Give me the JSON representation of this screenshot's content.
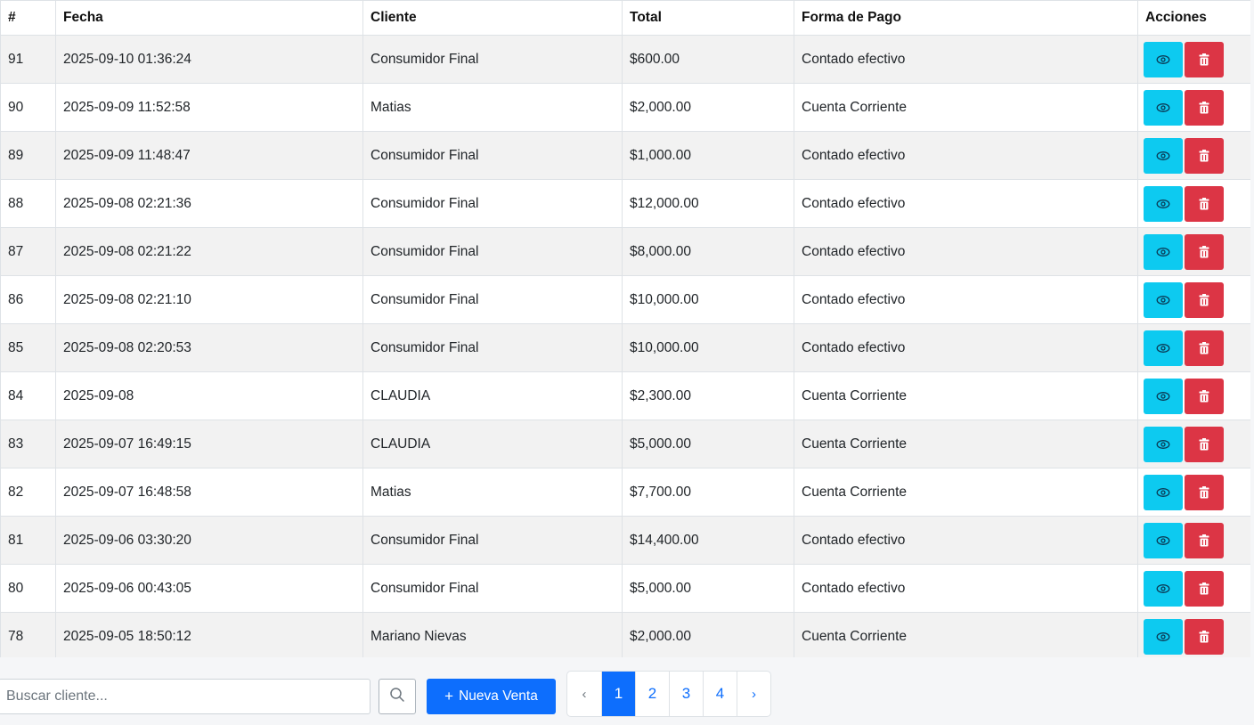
{
  "table": {
    "headers": [
      "#",
      "Fecha",
      "Cliente",
      "Total",
      "Forma de Pago",
      "Acciones"
    ],
    "rows": [
      {
        "id": "91",
        "fecha": "2025-09-10 01:36:24",
        "cliente": "Consumidor Final",
        "total": "$600.00",
        "pago": "Contado efectivo"
      },
      {
        "id": "90",
        "fecha": "2025-09-09 11:52:58",
        "cliente": "Matias",
        "total": "$2,000.00",
        "pago": "Cuenta Corriente"
      },
      {
        "id": "89",
        "fecha": "2025-09-09 11:48:47",
        "cliente": "Consumidor Final",
        "total": "$1,000.00",
        "pago": "Contado efectivo"
      },
      {
        "id": "88",
        "fecha": "2025-09-08 02:21:36",
        "cliente": "Consumidor Final",
        "total": "$12,000.00",
        "pago": "Contado efectivo"
      },
      {
        "id": "87",
        "fecha": "2025-09-08 02:21:22",
        "cliente": "Consumidor Final",
        "total": "$8,000.00",
        "pago": "Contado efectivo"
      },
      {
        "id": "86",
        "fecha": "2025-09-08 02:21:10",
        "cliente": "Consumidor Final",
        "total": "$10,000.00",
        "pago": "Contado efectivo"
      },
      {
        "id": "85",
        "fecha": "2025-09-08 02:20:53",
        "cliente": "Consumidor Final",
        "total": "$10,000.00",
        "pago": "Contado efectivo"
      },
      {
        "id": "84",
        "fecha": "2025-09-08",
        "cliente": "CLAUDIA",
        "total": "$2,300.00",
        "pago": "Cuenta Corriente"
      },
      {
        "id": "83",
        "fecha": "2025-09-07 16:49:15",
        "cliente": "CLAUDIA",
        "total": "$5,000.00",
        "pago": "Cuenta Corriente"
      },
      {
        "id": "82",
        "fecha": "2025-09-07 16:48:58",
        "cliente": "Matias",
        "total": "$7,700.00",
        "pago": "Cuenta Corriente"
      },
      {
        "id": "81",
        "fecha": "2025-09-06 03:30:20",
        "cliente": "Consumidor Final",
        "total": "$14,400.00",
        "pago": "Contado efectivo"
      },
      {
        "id": "80",
        "fecha": "2025-09-06 00:43:05",
        "cliente": "Consumidor Final",
        "total": "$5,000.00",
        "pago": "Contado efectivo"
      },
      {
        "id": "78",
        "fecha": "2025-09-05 18:50:12",
        "cliente": "Mariano Nievas",
        "total": "$2,000.00",
        "pago": "Cuenta Corriente"
      }
    ],
    "actions": {
      "view_icon": "eye-icon",
      "delete_icon": "trash-icon"
    }
  },
  "footer": {
    "search_placeholder": "Buscar cliente...",
    "search_value": "",
    "search_icon": "search-icon",
    "new_sale_plus": "+",
    "new_sale_label": "Nueva Venta",
    "pagination": {
      "prev": "‹",
      "pages": [
        "1",
        "2",
        "3",
        "4"
      ],
      "active": "1",
      "next": "›"
    }
  },
  "colors": {
    "primary": "#0d6efd",
    "info": "#0dcaf0",
    "danger": "#dc3545",
    "stripe": "#f2f2f2"
  }
}
